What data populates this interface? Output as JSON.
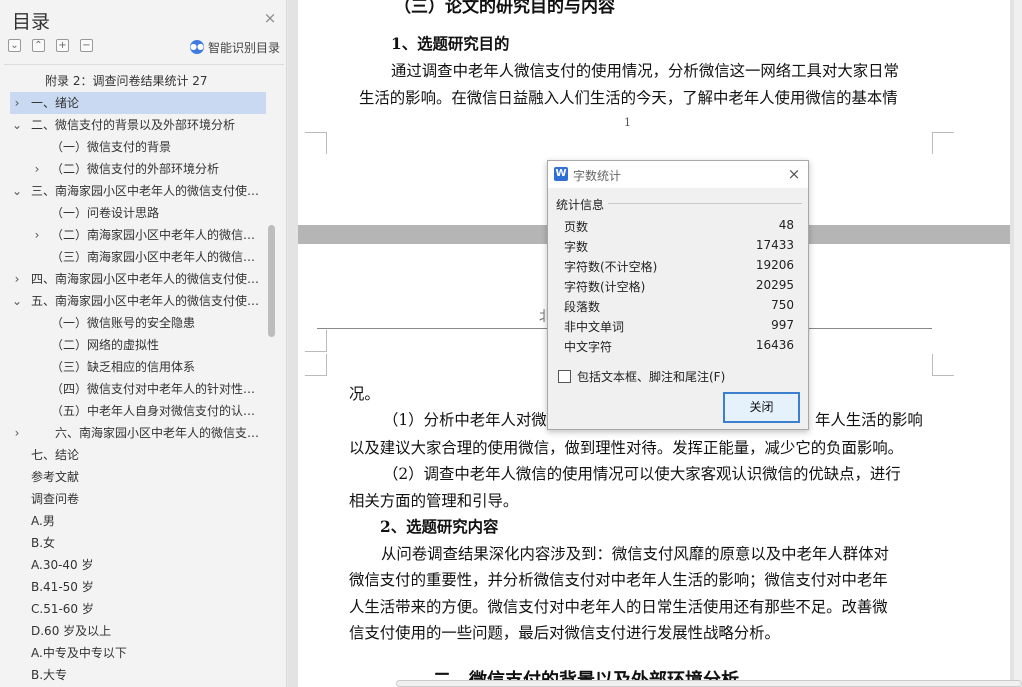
{
  "sidebar": {
    "title": "目录",
    "close_icon": "×",
    "tool_icons": [
      "⌄",
      "⌃",
      "+",
      "−"
    ],
    "smart_label": "智能识别目录",
    "toc": [
      {
        "label": "附录 2：调查问卷结果统计  27",
        "arrow": "",
        "selected": false
      },
      {
        "label": "一、绪论",
        "arrow": "›",
        "selected": true
      },
      {
        "label": "二、微信支付的背景以及外部环境分析",
        "arrow": "⌄",
        "selected": false
      },
      {
        "label": "（一）微信支付的背景",
        "arrow": "",
        "selected": false
      },
      {
        "label": "（二）微信支付的外部环境分析",
        "arrow": "›",
        "selected": false
      },
      {
        "label": "三、南海家园小区中老年人的微信支付使用情况",
        "arrow": "⌄",
        "selected": false
      },
      {
        "label": "（一）问卷设计思路",
        "arrow": "",
        "selected": false
      },
      {
        "label": "（二）南海家园小区中老年人的微信支付使用",
        "arrow": "›",
        "selected": false
      },
      {
        "label": "（三）南海家园小区中老年人的微信支付使用",
        "arrow": "",
        "selected": false
      },
      {
        "label": "四、南海家园小区中老年人的微信支付使用问题",
        "arrow": "›",
        "selected": false
      },
      {
        "label": "五、南海家园小区中老年人的微信支付使用原因",
        "arrow": "⌄",
        "selected": false
      },
      {
        "label": "（一）微信账号的安全隐患",
        "arrow": "",
        "selected": false
      },
      {
        "label": "（二）网络的虚拟性",
        "arrow": "",
        "selected": false
      },
      {
        "label": "（三）缺乏相应的信用体系",
        "arrow": "",
        "selected": false
      },
      {
        "label": "（四）微信支付对中老年人的针对性不强",
        "arrow": "",
        "selected": false
      },
      {
        "label": "（五）中老年人自身对微信支付的认识不足",
        "arrow": "",
        "selected": false
      },
      {
        "label": "六、南海家园小区中老年人的微信支付对策",
        "arrow": "›",
        "selected": false
      },
      {
        "label": "七、结论",
        "arrow": "",
        "selected": false
      },
      {
        "label": "参考文献",
        "arrow": "",
        "selected": false
      },
      {
        "label": "调查问卷",
        "arrow": "",
        "selected": false
      },
      {
        "label": "A.男",
        "arrow": "",
        "selected": false
      },
      {
        "label": "B.女",
        "arrow": "",
        "selected": false
      },
      {
        "label": "A.30-40 岁",
        "arrow": "",
        "selected": false
      },
      {
        "label": "B.41-50 岁",
        "arrow": "",
        "selected": false
      },
      {
        "label": "C.51-60 岁",
        "arrow": "",
        "selected": false
      },
      {
        "label": "D.60 岁及以上",
        "arrow": "",
        "selected": false
      },
      {
        "label": "A.中专及中专以下",
        "arrow": "",
        "selected": false
      },
      {
        "label": "B.大专",
        "arrow": "",
        "selected": false
      }
    ]
  },
  "document": {
    "page1": {
      "heading": "（三）论文的研究目的与内容",
      "sub1": "1、选题研究目的",
      "p1_line1": "通过调查中老年人微信支付的使用情况，分析微信这一网络工具对大家日常",
      "p1_line2": "生活的影响。在微信日益融入人们生活的今天，了解中老年人使用微信的基本情",
      "page_number": "1"
    },
    "page2": {
      "header_char": "北",
      "line_kuang": "况。",
      "p2_line1_left": "（1）分析中老年人对微信",
      "p2_line1_right": "年人生活的影响",
      "p2_line2": "以及建议大家合理的使用微信，做到理性对待。发挥正能量，减少它的负面影响。",
      "p3_line1": "（2）调查中老年人微信的使用情况可以使大家客观认识微信的优缺点，进行",
      "p3_line2": "相关方面的管理和引导。",
      "sub2": "2、选题研究内容",
      "p4_line1": "从问卷调查结果深化内容涉及到：微信支付风靡的原意以及中老年人群体对",
      "p4_line2": "微信支付的重要性，并分析微信支付对中老年人生活的影响；微信支付对中老年",
      "p4_line3": "人生活带来的方便。微信支付对中老年人的日常生活使用还有那些不足。改善微",
      "p4_line4": "信支付使用的一些问题，最后对微信支付进行发展性战略分析。",
      "cut_heading": "二、微信支付的背景以及外部环境分析"
    }
  },
  "dialog": {
    "icon_letter": "W",
    "title": "字数统计",
    "close_icon": "×",
    "group_label": "统计信息",
    "stats": [
      {
        "label": "页数",
        "value": "48"
      },
      {
        "label": "字数",
        "value": "17433"
      },
      {
        "label": "字符数(不计空格)",
        "value": "19206"
      },
      {
        "label": "字符数(计空格)",
        "value": "20295"
      },
      {
        "label": "段落数",
        "value": "750"
      },
      {
        "label": "非中文单词",
        "value": "997"
      },
      {
        "label": "中文字符",
        "value": "16436"
      }
    ],
    "checkbox_label": "包括文本框、脚注和尾注(F)",
    "checkbox_checked": false,
    "close_button": "关闭"
  }
}
